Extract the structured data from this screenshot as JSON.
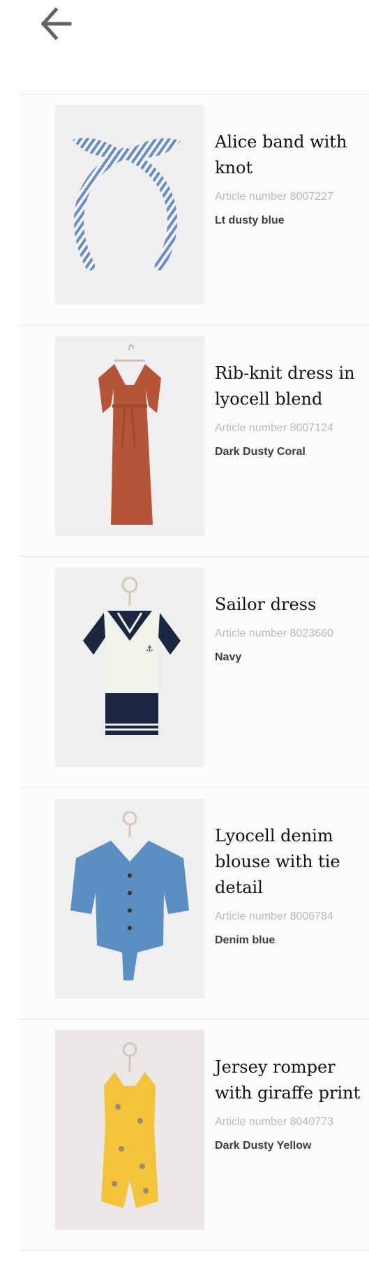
{
  "header": {
    "back_icon": "arrow-left-icon"
  },
  "products": [
    {
      "title": "Alice band with knot",
      "article": "Article number 8007227",
      "color": "Lt dusty blue"
    },
    {
      "title": "Rib-knit dress in lyocell blend",
      "article": "Article number 8007124",
      "color": "Dark Dusty Coral"
    },
    {
      "title": "Sailor dress",
      "article": "Article number 8023660",
      "color": "Navy"
    },
    {
      "title": "Lyocell denim blouse with tie detail",
      "article": "Article number 8006784",
      "color": "Denim blue"
    },
    {
      "title": "Jersey romper with giraffe print",
      "article": "Article number 8040773",
      "color": "Dark Dusty Yellow"
    }
  ],
  "colors": {
    "divider": "#e6e6e6",
    "title": "#111111",
    "article": "#b9b9b9",
    "color_label": "#3d3d3d"
  }
}
